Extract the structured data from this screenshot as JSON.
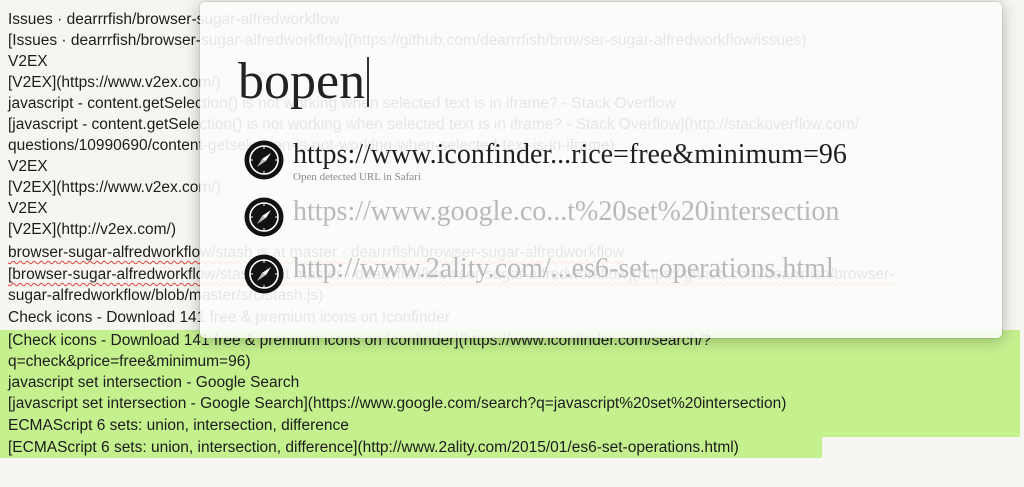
{
  "editor": {
    "lines": [
      "Issues · dearrrfish/browser-sugar-alfredworkflow",
      "[Issues · dearrrfish/browser-sugar-alfredworkflow](https://github.com/dearrrfish/browser-sugar-alfredworkflow/issues)",
      "V2EX",
      "[V2EX](https://www.v2ex.com/)",
      "javascript - content.getSelection() is not working when selected text is in iframe? - Stack Overflow",
      "[javascript - content.getSelection() is not working when selected text is in iframe? - Stack Overflow](http://stackoverflow.com/",
      "questions/10990690/content-getselection-is-not-working-when-selected-text-is-in-iframe)",
      "V2EX",
      "[V2EX](https://www.v2ex.com/)",
      "V2EX",
      "[V2EX](http://v2ex.com/)",
      "browser-sugar-alfredworkflow/stash.js at master · dearrrfish/browser-sugar-alfredworkflow",
      "[browser-sugar-alfredworkflow/stash.js at master · dearrrfish/browser-sugar-alfredworkflow](https://github.com/dearrrfish/browser-",
      "sugar-alfredworkflow/blob/master/src/stash.js)",
      "Check icons - Download 141 free & premium icons on Iconfinder",
      "[Check icons - Download 141 free & premium icons on Iconfinder](https://www.iconfinder.com/search/?",
      "q=check&price=free&minimum=96)",
      "javascript set intersection - Google Search",
      "[javascript set intersection - Google Search](https://www.google.com/search?q=javascript%20set%20intersection)",
      "ECMAScript 6 sets: union, intersection, difference",
      "[ECMAScript 6 sets: union, intersection, difference](http://www.2ality.com/2015/01/es6-set-operations.html)"
    ]
  },
  "alfred": {
    "query": "bopen",
    "results": [
      {
        "title": "https://www.iconfinder...rice=free&minimum=96",
        "subtitle": "Open detected URL in Safari",
        "icon": "safari-compass-icon"
      },
      {
        "title": "https://www.google.co...t%20set%20intersection",
        "subtitle": "",
        "icon": "safari-compass-icon"
      },
      {
        "title": "http://www.2ality.com/...es6-set-operations.html",
        "subtitle": "",
        "icon": "safari-compass-icon"
      }
    ]
  },
  "colors": {
    "selection": "#c4f08e",
    "editor_background": "#f6f5f1",
    "spellcheck_underline": "#e3453b"
  }
}
